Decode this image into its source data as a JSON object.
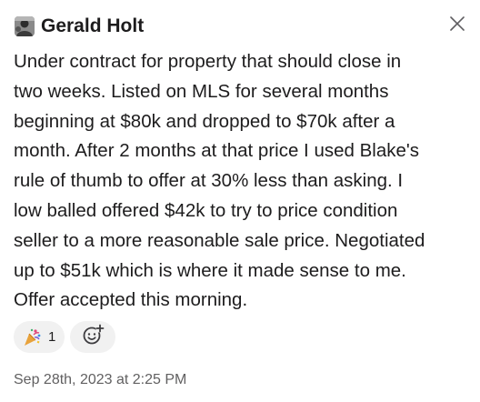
{
  "message": {
    "author": "Gerald Holt",
    "lines": [
      "Under contract for property that should close in",
      "two weeks. Listed on MLS for several months",
      "beginning at $80k and dropped to $70k after a",
      "month. After 2 months at that price I used Blake's",
      "rule of thumb to offer at 30% less than asking. I",
      "low balled offered $42k to try to price condition",
      "seller to a more reasonable sale price. Negotiated",
      "up to $51k which is where it made sense to me.",
      "Offer accepted this morning."
    ],
    "timestamp": "Sep 28th, 2023 at 2:25 PM"
  },
  "reactions": [
    {
      "icon": "party-popper-icon",
      "count": "1"
    }
  ],
  "icons": {
    "close": "close-icon",
    "add_reaction": "add-reaction-icon"
  },
  "colors": {
    "text": "#1d1c1d",
    "muted": "#616061",
    "pill_background": "#f1f1f1"
  }
}
